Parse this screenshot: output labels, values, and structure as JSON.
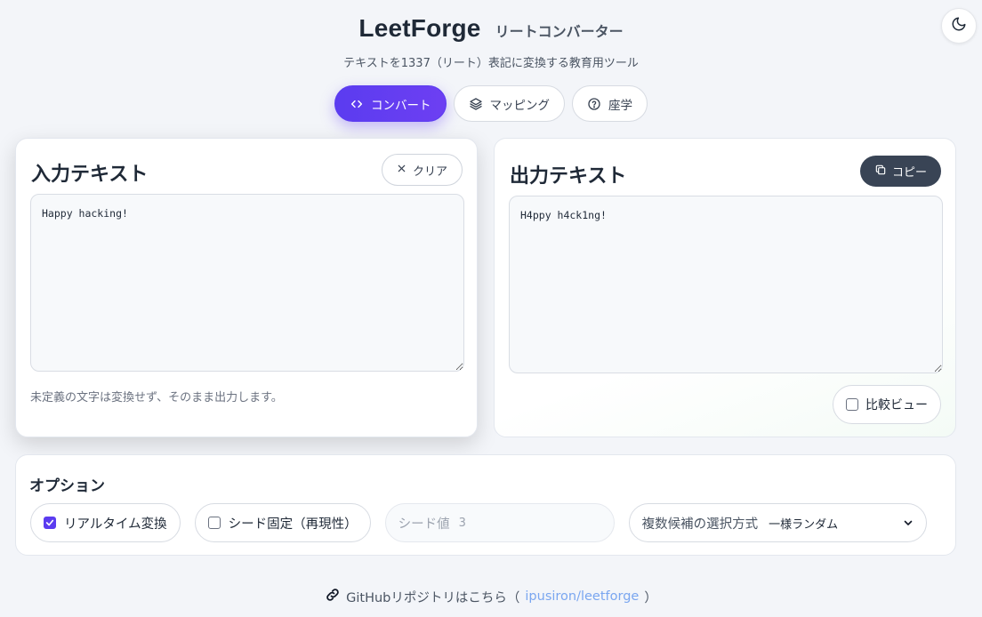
{
  "header": {
    "title": "LeetForge",
    "subtitle": "リートコンバーター",
    "tagline": "テキストを1337（リート）表記に変換する教育用ツール"
  },
  "tabs": [
    {
      "label": "コンバート",
      "icon": "code-icon",
      "active": true
    },
    {
      "label": "マッピング",
      "icon": "layers-icon",
      "active": false
    },
    {
      "label": "座学",
      "icon": "help-circle-icon",
      "active": false
    }
  ],
  "input_panel": {
    "title": "入力テキスト",
    "clear_label": "クリア",
    "value": "Happy hacking!",
    "note": "未定義の文字は変換せず、そのまま出力します。"
  },
  "output_panel": {
    "title": "出力テキスト",
    "copy_label": "コピー",
    "value": "H4ppy h4ck1ng!",
    "compare_label": "比較ビュー",
    "compare_checked": false
  },
  "options": {
    "title": "オプション",
    "realtime_label": "リアルタイム変換",
    "realtime_checked": true,
    "seed_fixed_label": "シード固定（再現性）",
    "seed_fixed_checked": false,
    "seed_label": "シード値",
    "seed_value": "3",
    "selection_label": "複数候補の選択方式",
    "selection_value": "一様ランダム"
  },
  "footer": {
    "text": "GitHubリポジトリはこちら（",
    "link": "ipusiron/leetforge",
    "close": "）"
  },
  "theme_toggle": {
    "icon": "moon-icon"
  },
  "colors": {
    "accent": "#5b3cf0",
    "copy_button": "#394455",
    "background": "#f3f5f9",
    "link": "#7aa6f0"
  }
}
